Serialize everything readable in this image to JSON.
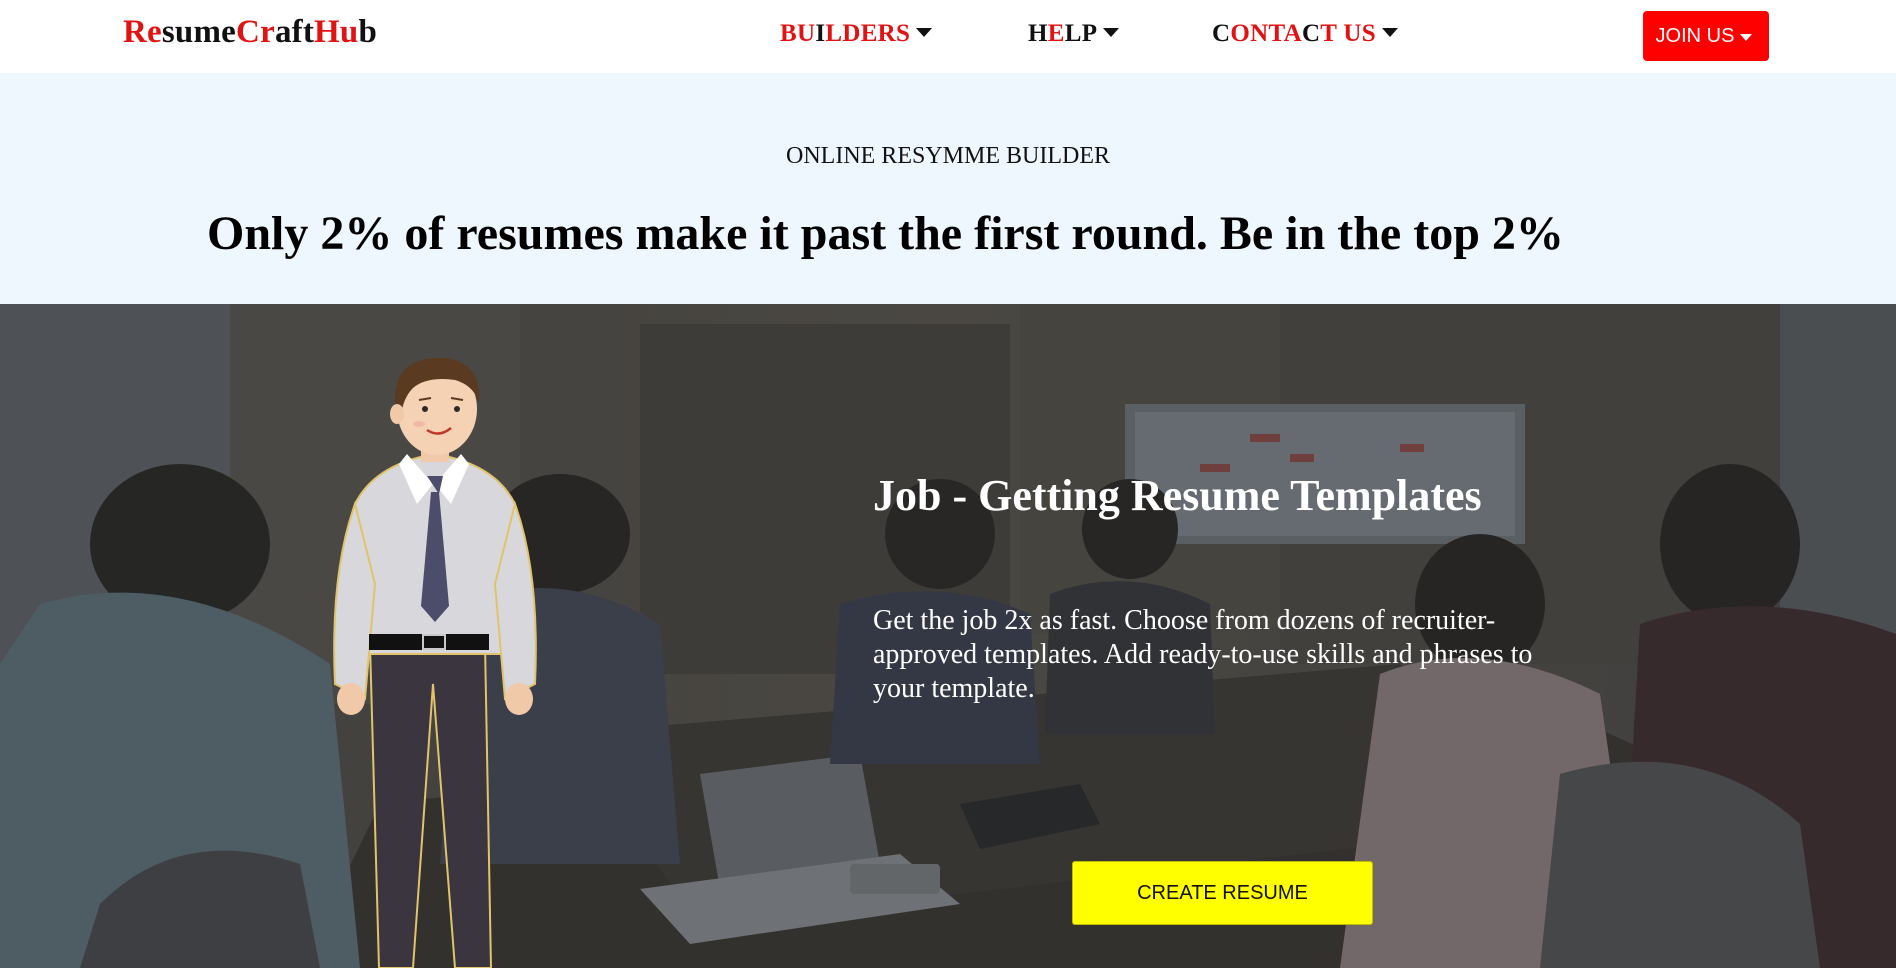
{
  "header": {
    "logo": {
      "parts": [
        "Re",
        "sume",
        "C",
        "r",
        "a",
        "ft",
        "Hu",
        "b"
      ],
      "text": "ResumeCraftHub"
    },
    "nav": {
      "builders": {
        "parts": [
          "BU",
          "I",
          "LDERS"
        ],
        "text": "BUILDERS"
      },
      "help": {
        "parts": [
          "H",
          "E",
          "LP"
        ],
        "text": "HELP"
      },
      "contact": {
        "parts": [
          "C",
          "ONTA",
          "C",
          "T US"
        ],
        "text": "CONTACT US"
      }
    },
    "join_label": "JOIN US"
  },
  "banner": {
    "kicker": "ONLINE RESYMME BUILDER",
    "headline": "Only 2% of resumes make it past the first round. Be in the top 2%"
  },
  "hero": {
    "title": "Job - Getting Resume Templates",
    "description": "Get the job 2x as fast. Choose from dozens of recruiter-approved templates. Add ready-to-use skills and phrases to your template.",
    "cta_label": "CREATE RESUME"
  },
  "colors": {
    "accent_red": "#e01212",
    "join_button": "#ff0000",
    "cta_button": "#ffff00",
    "banner_bg": "#eef6fe"
  },
  "icons": [
    "caret-down-icon"
  ]
}
